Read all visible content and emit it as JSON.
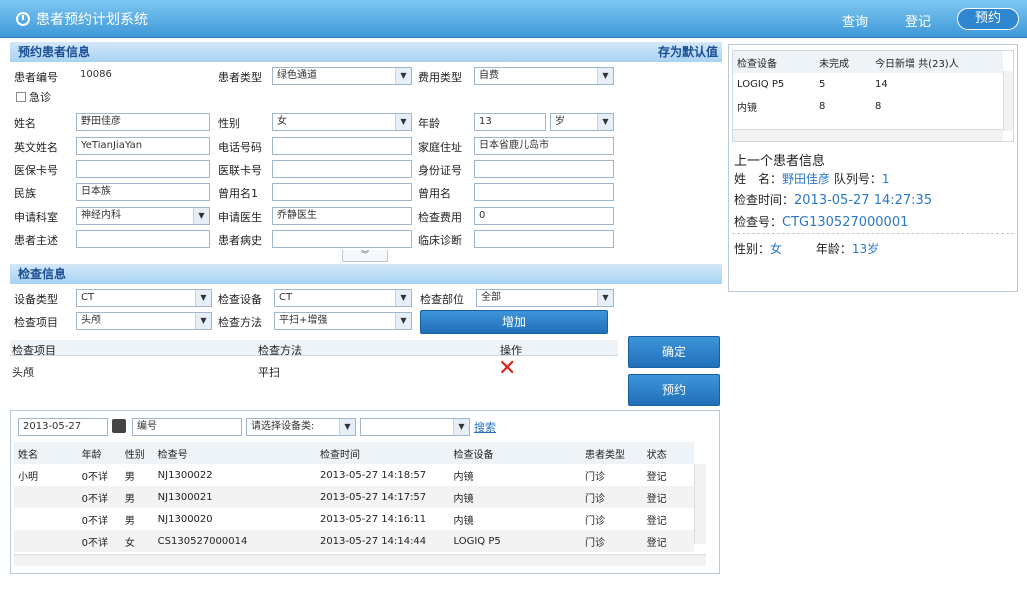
{
  "app": {
    "title": "患者预约计划系统"
  },
  "nav": {
    "query": "查询",
    "register": "登记",
    "appoint": "预约"
  },
  "patient_section": {
    "title": "预约患者信息",
    "save_default": "存为默认值",
    "labels": {
      "patient_no": "患者编号",
      "patient_type": "患者类型",
      "fee_type": "费用类型",
      "emergency": "急诊",
      "name": "姓名",
      "gender": "性别",
      "age": "年龄",
      "en_name": "英文姓名",
      "phone": "电话号码",
      "address": "家庭住址",
      "medical_card": "医保卡号",
      "union_card": "医联卡号",
      "id_no": "身份证号",
      "ethnicity": "民族",
      "alias1": "曾用名1",
      "alias2": "曾用名",
      "dept": "申请科室",
      "doctor": "申请医生",
      "exam_fee": "检查费用",
      "complaint": "患者主述",
      "history": "患者病史",
      "diagnosis": "临床诊断"
    },
    "values": {
      "patient_no": "10086",
      "patient_type": "绿色通道",
      "fee_type": "自费",
      "name": "野田佳彦",
      "gender": "女",
      "age": "13",
      "age_unit": "岁",
      "en_name": "YeTianJiaYan",
      "phone": "",
      "address": "日本省鹿儿岛市",
      "medical_card": "",
      "union_card": "",
      "id_no": "",
      "ethnicity": "日本族",
      "alias1": "",
      "alias2": "",
      "dept": "神经内科",
      "doctor": "乔静医生",
      "exam_fee": "0",
      "complaint": "",
      "history": "",
      "diagnosis": ""
    },
    "collapse_icon": "double-chevron-down"
  },
  "exam_section": {
    "title": "检查信息",
    "labels": {
      "device_type": "设备类型",
      "device": "检查设备",
      "body_part": "检查部位",
      "item": "检查项目",
      "method": "检查方法"
    },
    "values": {
      "device_type": "CT",
      "device": "CT",
      "body_part": "全部",
      "item": "头颅",
      "method": "平扫+增强"
    },
    "add_button": "增加",
    "table": {
      "headers": [
        "检查项目",
        "检查方法",
        "操作"
      ],
      "rows": [
        {
          "item": "头颅",
          "method": "平扫"
        }
      ]
    },
    "confirm_button": "确定",
    "appoint_button": "预约"
  },
  "search_bar": {
    "date": "2013-05-27",
    "field": "编号",
    "device_placeholder": "请选择设备类:",
    "extra": "",
    "search_link": "搜索"
  },
  "appointments": {
    "headers": [
      "姓名",
      "年龄",
      "性别",
      "检查号",
      "检查时间",
      "检查设备",
      "患者类型",
      "状态"
    ],
    "rows": [
      {
        "name": "小明",
        "age": "0不详",
        "gender": "男",
        "no": "NJ1300022",
        "time": "2013-05-27 14:18:57",
        "device": "内镜",
        "ptype": "门诊",
        "status": "登记"
      },
      {
        "name": "",
        "age": "0不详",
        "gender": "男",
        "no": "NJ1300021",
        "time": "2013-05-27 14:17:57",
        "device": "内镜",
        "ptype": "门诊",
        "status": "登记"
      },
      {
        "name": "",
        "age": "0不详",
        "gender": "男",
        "no": "NJ1300020",
        "time": "2013-05-27 14:16:11",
        "device": "内镜",
        "ptype": "门诊",
        "status": "登记"
      },
      {
        "name": "",
        "age": "0不详",
        "gender": "女",
        "no": "CS130527000014",
        "time": "2013-05-27 14:14:44",
        "device": "LOGIQ P5",
        "ptype": "门诊",
        "status": "登记"
      }
    ]
  },
  "device_stats": {
    "headers": [
      "检查设备",
      "未完成",
      "今日新增 共(23)人"
    ],
    "rows": [
      {
        "device": "LOGIQ P5",
        "pending": "5",
        "new": "14"
      },
      {
        "device": "内镜",
        "pending": "8",
        "new": "8"
      }
    ]
  },
  "last_patient": {
    "title": "上一个患者信息",
    "name_label": "姓　名：",
    "name": "野田佳彦",
    "queue_label": "队列号：",
    "queue": "1",
    "time_label": "检查时间：",
    "time": "2013-05-27 14:27:35",
    "no_label": "检查号：",
    "no": "CTG130527000001",
    "gender_label": "性别：",
    "gender": "女",
    "age_label": "年龄：",
    "age": "13岁"
  }
}
